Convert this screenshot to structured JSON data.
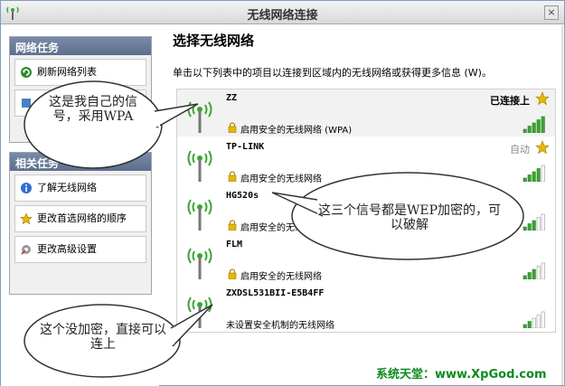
{
  "window": {
    "title": "无线网络连接",
    "close_glyph": "×"
  },
  "sidebar": {
    "network_tasks": {
      "heading": "网络任务",
      "items": [
        {
          "label": "刷新网络列表",
          "icon": "refresh-icon"
        },
        {
          "label": "",
          "icon": "setup-icon"
        }
      ]
    },
    "related_tasks": {
      "heading": "相关任务",
      "items": [
        {
          "label": "了解无线网络",
          "icon": "info-icon"
        },
        {
          "label": "更改首选网络的顺序",
          "icon": "star-icon"
        },
        {
          "label": "更改高级设置",
          "icon": "settings-icon"
        }
      ]
    }
  },
  "main": {
    "title": "选择无线网络",
    "description": "单击以下列表中的项目以连接到区域内的无线网络或获得更多信息 (W)。"
  },
  "networks": [
    {
      "ssid": "ZZ",
      "security": "启用安全的无线网络 (WPA)",
      "status": "已连接上",
      "starred": true,
      "locked": true,
      "signal_bars": 5
    },
    {
      "ssid": "TP-LINK",
      "security": "启用安全的无线网络",
      "status": "自动",
      "starred": true,
      "locked": true,
      "signal_bars": 4
    },
    {
      "ssid": "HG520s",
      "security": "启用安全的无线网络",
      "status": "",
      "starred": false,
      "locked": true,
      "signal_bars": 3
    },
    {
      "ssid": "FLM",
      "security": "启用安全的无线网络",
      "status": "",
      "starred": false,
      "locked": true,
      "signal_bars": 3
    },
    {
      "ssid": "ZXDSL531BII-E5B4FF",
      "security": "未设置安全机制的无线网络",
      "status": "",
      "starred": false,
      "locked": false,
      "signal_bars": 2
    }
  ],
  "annotations": {
    "own_signal": "这是我自己的信号，采用WPA",
    "wep_note": "这三个信号都是WEP加密的，可以破解",
    "open_note": "这个没加密，直接可以连上"
  },
  "footer": {
    "watermark": "系统天堂：www.XpGod.com"
  },
  "colors": {
    "panel_header": "#5d6e8d",
    "signal_green": "#3aa632",
    "star_gold": "#e6b800",
    "watermark_green": "#0b8b1e"
  }
}
